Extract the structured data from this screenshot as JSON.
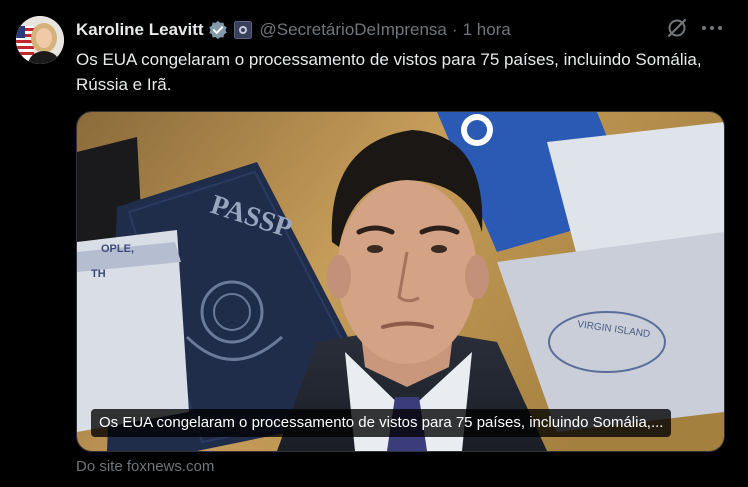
{
  "post": {
    "author_name": "Karoline Leavitt",
    "handle": "@SecretárioDeImprensa",
    "separator": "·",
    "time": "1 hora",
    "text": "Os EUA congelaram o processamento de vistos para 75 países, incluindo Somália, Rússia e Irã."
  },
  "link_card": {
    "caption": "Os EUA congelaram o processamento de vistos para 75 países, incluindo Somália,...",
    "source": "Do site foxnews.com",
    "image_text": {
      "passport": "PASSP",
      "people": "OPLE,",
      "th": "TH",
      "virgin": "VIRGIN ISLAND"
    }
  },
  "icons": {
    "verified": "verified-badge-icon",
    "government": "government-badge-icon",
    "grok": "grok-icon",
    "more": "more-dots-icon"
  },
  "colors": {
    "background": "#000000",
    "text_primary": "#e7e9ea",
    "text_secondary": "#71767b",
    "verified_blue": "#1d9bf0"
  }
}
